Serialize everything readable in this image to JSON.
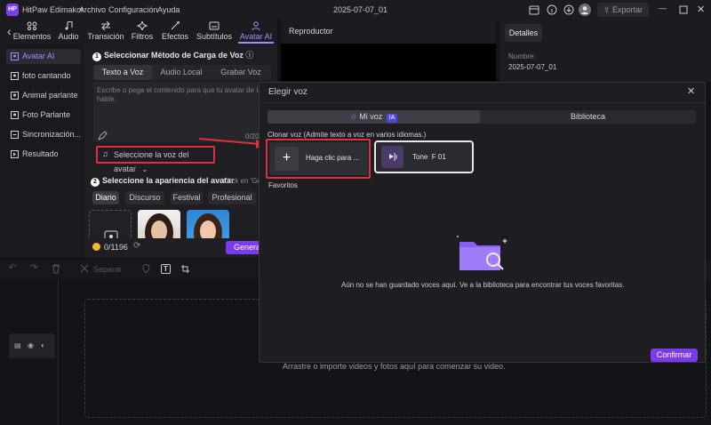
{
  "app": {
    "name": "HitPaw Edimakor",
    "date": "2025-07-07_01"
  },
  "menu": [
    "Archivo",
    "Configuración",
    "Ayuda"
  ],
  "titlebar": {
    "export_label": "Exportar"
  },
  "toolbar": {
    "items": [
      "Elementos",
      "Audio",
      "Transición",
      "Filtros",
      "Efectos",
      "Subtítulos",
      "Avatar AI"
    ],
    "active": "Avatar AI"
  },
  "sidebar": {
    "items": [
      "Avatar AI",
      "foto cantando",
      "Animal parlante",
      "Foto Parlante",
      "Sincronización...",
      "Resultado"
    ],
    "active": "Avatar AI"
  },
  "panel": {
    "step1_num": "1",
    "step1_title": "Seleccionar Método de Carga de Voz",
    "tabs": [
      "Texto a Voz",
      "Audio Local",
      "Grabar Voz"
    ],
    "placeholder": "Escribe o pega el contenido para que tu avatar de IA hable.",
    "char_count": "0/200",
    "select_voice": "Seleccione la voz del avatar",
    "step2_num": "2",
    "step2_title": "Seleccione la apariencia del avatar",
    "step2_hint": "Click en 'Ge",
    "categories": [
      "Diario",
      "Discurso",
      "Festival",
      "Profesional"
    ],
    "active_category": "Diario",
    "credits": "0/1196",
    "generate_label": "Generar"
  },
  "player": {
    "title": "Reproductor"
  },
  "details": {
    "tab": "Detalles",
    "name_label": "Nombre:",
    "name_value": "2025-07-07_01",
    "time_value": "2025-07-07_01"
  },
  "timeline": {
    "split_label": "Separar",
    "drop_hint": "Arrastre o importe videos y fotos aquí para comenzar su video."
  },
  "dialog": {
    "title": "Elegir voz",
    "tabs": [
      "Mi voz",
      "Biblioteca"
    ],
    "ia_badge": "IA",
    "clone_label": "Clonar voz (Admite texto a voz en varios idiomas.)",
    "add_card_label": "Haga clic para ...",
    "voice_card_label": "Tone  F 01",
    "favorites_label": "Favoritos",
    "empty_message": "Aún no se han guardado voces aquí. Ve a la biblioteca para encontrar tus voces favoritas.",
    "confirm_label": "Confirmar"
  },
  "colors": {
    "accent": "#7c3aed",
    "highlight": "#e0303a",
    "active_text": "#a78bfa"
  }
}
